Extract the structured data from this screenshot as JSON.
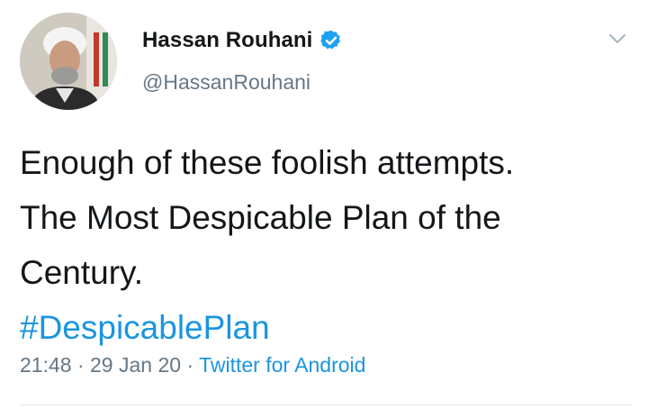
{
  "tweet": {
    "display_name": "Hassan Rouhani",
    "handle": "@HassanRouhani",
    "text_lines": [
      "Enough of these foolish attempts.",
      "The Most Despicable Plan of the",
      "Century."
    ],
    "hashtag": "#DespicablePlan",
    "time": "21:48",
    "separator": "·",
    "date": "29 Jan 20",
    "source": "Twitter for Android"
  },
  "icons": {
    "verified": "verified-badge-icon",
    "menu": "chevron-down-icon"
  },
  "colors": {
    "text": "#14171a",
    "secondary": "#657786",
    "link": "#1b95e0",
    "verified": "#1da1f2"
  }
}
